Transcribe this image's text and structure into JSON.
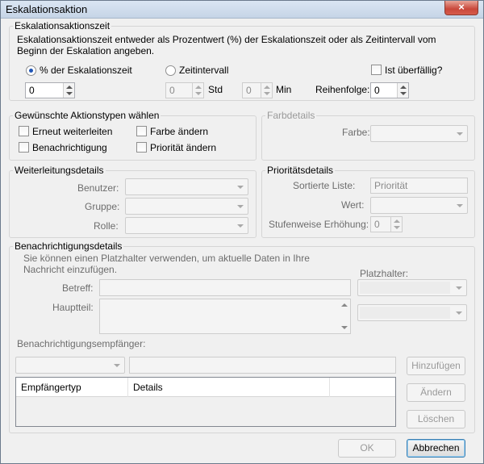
{
  "window": {
    "title": "Eskalationsaktion",
    "close_icon": "×"
  },
  "escalation_time": {
    "group_label": "Eskalationsaktionszeit",
    "description": "Eskalationsaktionszeit entweder als Prozentwert (%) der Eskalationszeit oder als Zeitintervall vom Beginn der Eskalation angeben.",
    "percent_radio_label": "% der Eskalationszeit",
    "percent_value": "0",
    "interval_radio_label": "Zeitintervall",
    "hours_value": "0",
    "hours_unit": "Std",
    "minutes_value": "0",
    "minutes_unit": "Min",
    "overdue_label": "Ist  überfällig?",
    "order_label": "Reihenfolge:",
    "order_value": "0"
  },
  "action_types": {
    "group_label": "Gewünschte Aktionstypen wählen",
    "forward_label": "Erneut weiterleiten",
    "color_label": "Farbe ändern",
    "notify_label": "Benachrichtigung",
    "priority_label": "Priorität ändern"
  },
  "color_details": {
    "group_label": "Farbdetails",
    "color_label": "Farbe:"
  },
  "forward_details": {
    "group_label": "Weiterleitungsdetails",
    "user_label": "Benutzer:",
    "group_field_label": "Gruppe:",
    "role_label": "Rolle:"
  },
  "priority_details": {
    "group_label": "Prioritätsdetails",
    "sorted_list_label": "Sortierte Liste:",
    "sorted_list_value": "Priorität",
    "value_label": "Wert:",
    "step_label": "Stufenweise Erhöhung:",
    "step_value": "0"
  },
  "notification": {
    "group_label": "Benachrichtigungsdetails",
    "hint": "Sie können einen Platzhalter verwenden, um aktuelle Daten in Ihre Nachricht einzufügen.",
    "placeholder_label": "Platzhalter:",
    "subject_label": "Betreff:",
    "body_label": "Hauptteil:",
    "recipients_label": "Benachrichtigungsempfänger:",
    "add_button": "Hinzufügen",
    "change_button": "Ändern",
    "delete_button": "Löschen",
    "columns": [
      "Empfängertyp",
      "Details"
    ]
  },
  "footer": {
    "ok_button": "OK",
    "cancel_button": "Abbrechen"
  }
}
